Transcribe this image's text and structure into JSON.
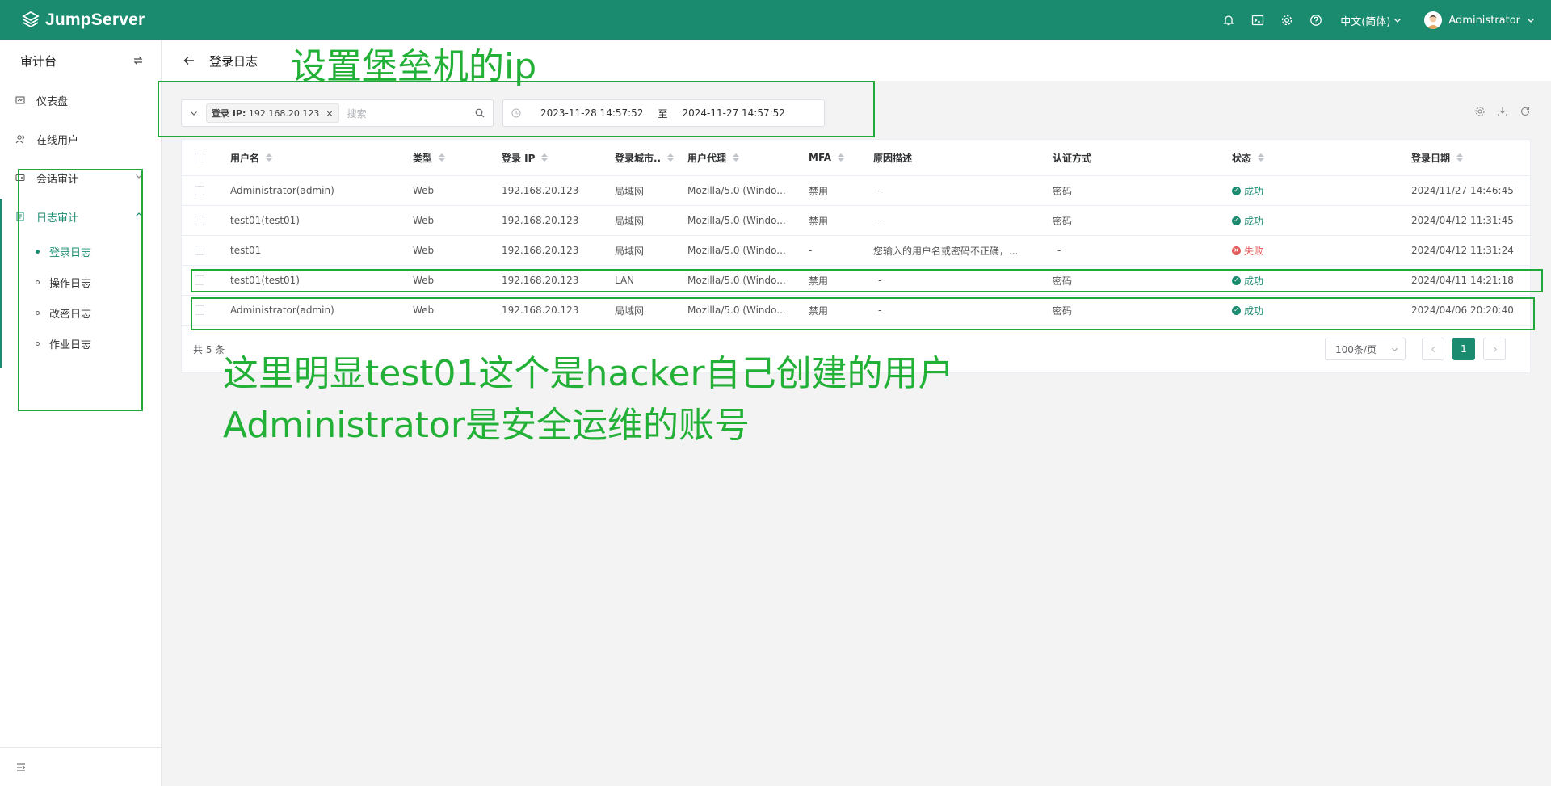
{
  "app": {
    "name": "JumpServer"
  },
  "topbar": {
    "language": "中文(简体)",
    "user": "Administrator"
  },
  "sidebar": {
    "title": "审计台",
    "items": [
      {
        "label": "仪表盘",
        "icon": "dashboard-icon"
      },
      {
        "label": "在线用户",
        "icon": "online-users-icon"
      },
      {
        "label": "会话审计",
        "icon": "session-audit-icon"
      },
      {
        "label": "日志审计",
        "icon": "log-audit-icon"
      }
    ],
    "sub_items": [
      {
        "label": "登录日志",
        "active": true
      },
      {
        "label": "操作日志"
      },
      {
        "label": "改密日志"
      },
      {
        "label": "作业日志"
      }
    ]
  },
  "page": {
    "title": "登录日志"
  },
  "filter": {
    "tag_key": "登录 IP:",
    "tag_value": "192.168.20.123",
    "tag_close": "×",
    "search_placeholder": "搜索",
    "date_start": "2023-11-28 14:57:52",
    "date_separator": "至",
    "date_end": "2024-11-27 14:57:52"
  },
  "table": {
    "columns": [
      "用户名",
      "类型",
      "登录 IP",
      "登录城市..",
      "用户代理",
      "MFA",
      "原因描述",
      "认证方式",
      "状态",
      "登录日期"
    ],
    "rows": [
      {
        "user": "Administrator(admin)",
        "type": "Web",
        "ip": "192.168.20.123",
        "city": "局域网",
        "agent": "Mozilla/5.0 (Windo...",
        "mfa": "禁用",
        "reason": "-",
        "auth": "密码",
        "status": "成功",
        "status_ok": true,
        "date": "2024/11/27 14:46:45"
      },
      {
        "user": "test01(test01)",
        "type": "Web",
        "ip": "192.168.20.123",
        "city": "局域网",
        "agent": "Mozilla/5.0 (Windo...",
        "mfa": "禁用",
        "reason": "-",
        "auth": "密码",
        "status": "成功",
        "status_ok": true,
        "date": "2024/04/12 11:31:45"
      },
      {
        "user": "test01",
        "type": "Web",
        "ip": "192.168.20.123",
        "city": "局域网",
        "agent": "Mozilla/5.0 (Windo...",
        "mfa": "-",
        "reason": "您输入的用户名或密码不正确，...",
        "auth": "-",
        "status": "失败",
        "status_ok": false,
        "date": "2024/04/12 11:31:24"
      },
      {
        "user": "test01(test01)",
        "type": "Web",
        "ip": "192.168.20.123",
        "city": "LAN",
        "agent": "Mozilla/5.0 (Windo...",
        "mfa": "禁用",
        "reason": "-",
        "auth": "密码",
        "status": "成功",
        "status_ok": true,
        "date": "2024/04/11 14:21:18"
      },
      {
        "user": "Administrator(admin)",
        "type": "Web",
        "ip": "192.168.20.123",
        "city": "局域网",
        "agent": "Mozilla/5.0 (Windo...",
        "mfa": "禁用",
        "reason": "-",
        "auth": "密码",
        "status": "成功",
        "status_ok": true,
        "date": "2024/04/06 20:20:40"
      }
    ],
    "total": "共 5 条",
    "page_size": "100条/页",
    "current_page": "1"
  },
  "annotations": {
    "ip_note": "设置堡垒机的ip",
    "line1": "这里明显test01这个是hacker自己创建的用户",
    "line2": "Administrator是安全运维的账号"
  },
  "colors": {
    "brand": "#1b8b6f",
    "annotation": "#22b037",
    "fail": "#e35d5d"
  }
}
